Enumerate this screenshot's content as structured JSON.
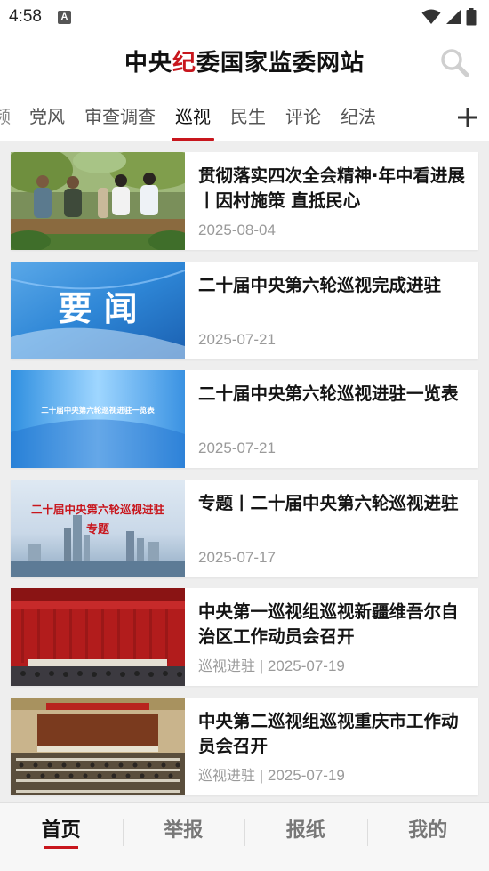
{
  "status_bar": {
    "time": "4:58",
    "notification_glyph": "A"
  },
  "header": {
    "title_part1": "中央",
    "title_accent": "纪",
    "title_part2": "委国家监委网站",
    "accent_color": "#c8161d"
  },
  "tabs": {
    "items": [
      {
        "label": "频",
        "partial": true
      },
      {
        "label": "党风"
      },
      {
        "label": "审查调查"
      },
      {
        "label": "巡视",
        "active": true
      },
      {
        "label": "民生"
      },
      {
        "label": "评论"
      },
      {
        "label": "纪法"
      }
    ],
    "add_label": "+"
  },
  "news": [
    {
      "title": "贯彻落实四次全会精神·年中看进展丨因村施策 直抵民心",
      "source": "",
      "date": "2025-08-04",
      "thumb": "village-meeting-photo"
    },
    {
      "title": "二十届中央第六轮巡视完成进驻",
      "source": "",
      "date": "2025-07-21",
      "thumb": "yaowen-banner",
      "thumb_text": "要 闻"
    },
    {
      "title": "二十届中央第六轮巡视进驻一览表",
      "source": "",
      "date": "2025-07-21",
      "thumb": "blue-banner",
      "thumb_text": "二十届中央第六轮巡视进驻一览表"
    },
    {
      "title": "专题丨二十届中央第六轮巡视进驻",
      "source": "",
      "date": "2025-07-17",
      "thumb": "city-skyline",
      "thumb_text": "二十届中央第六轮巡视进驻",
      "thumb_subtext": "专题"
    },
    {
      "title": "中央第一巡视组巡视新疆维吾尔自治区工作动员会召开",
      "source": "巡视进驻",
      "date": "2025-07-19",
      "thumb": "red-stage-meeting"
    },
    {
      "title": "中央第二巡视组巡视重庆市工作动员会召开",
      "source": "巡视进驻",
      "date": "2025-07-19",
      "thumb": "hall-meeting"
    }
  ],
  "bottom_nav": [
    {
      "label": "首页",
      "active": true
    },
    {
      "label": "举报"
    },
    {
      "label": "报纸"
    },
    {
      "label": "我的"
    }
  ]
}
